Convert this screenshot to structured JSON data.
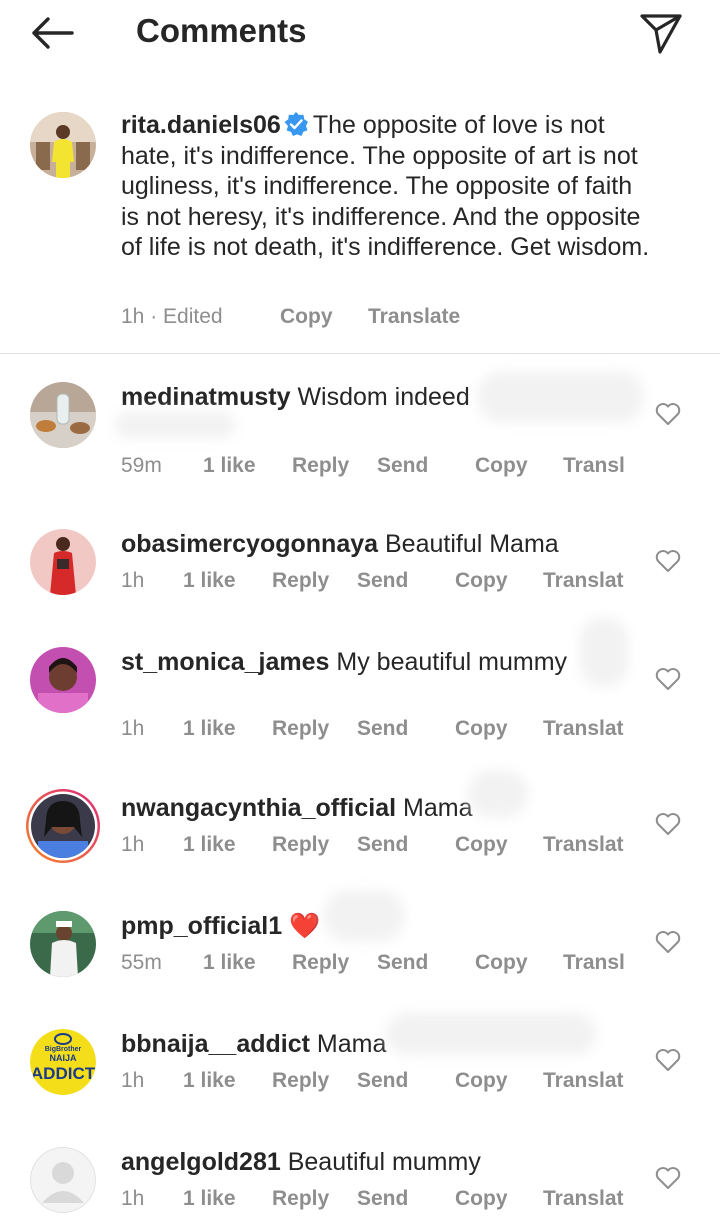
{
  "header": {
    "title": "Comments"
  },
  "caption": {
    "username": "rita.daniels06",
    "text": "The opposite of love is not hate, it's indifference. The opposite of art is not ugliness, it's indifference. The opposite of faith is not heresy, it's indifference. And the opposite of life is not death, it's indifference. Get wisdom.",
    "time": "1h · Edited",
    "copy": "Copy",
    "translate": "Translate"
  },
  "comments": [
    {
      "username": "medinatmusty",
      "text": "Wisdom indeed",
      "time": "59m",
      "likes": "1 like",
      "reply": "Reply",
      "send": "Send",
      "copy": "Copy",
      "translate": "Transl"
    },
    {
      "username": "obasimercyogonnaya",
      "text": "Beautiful Mama",
      "time": "1h",
      "likes": "1 like",
      "reply": "Reply",
      "send": "Send",
      "copy": "Copy",
      "translate": "Translat"
    },
    {
      "username": "st_monica_james",
      "text": "My beautiful mummy",
      "time": "1h",
      "likes": "1 like",
      "reply": "Reply",
      "send": "Send",
      "copy": "Copy",
      "translate": "Translat"
    },
    {
      "username": "nwangacynthia_official",
      "text": "Mama",
      "time": "1h",
      "likes": "1 like",
      "reply": "Reply",
      "send": "Send",
      "copy": "Copy",
      "translate": "Translat"
    },
    {
      "username": "pmp_official1",
      "text": "❤️",
      "time": "55m",
      "likes": "1 like",
      "reply": "Reply",
      "send": "Send",
      "copy": "Copy",
      "translate": "Transl"
    },
    {
      "username": "bbnaija__addict",
      "text": "Mama",
      "time": "1h",
      "likes": "1 like",
      "reply": "Reply",
      "send": "Send",
      "copy": "Copy",
      "translate": "Translat"
    },
    {
      "username": "angelgold281",
      "text": "Beautiful mummy",
      "time": "1h",
      "likes": "1 like",
      "reply": "Reply",
      "send": "Send",
      "copy": "Copy",
      "translate": "Translat"
    }
  ],
  "avatar_logo": {
    "line1": "BigBrother",
    "line2": "NAIJA",
    "line3": "ADDICT"
  },
  "colors": {
    "text": "#262626",
    "meta": "#8e8e8e",
    "verified": "#3897f0",
    "heart_emoji": "#e0302a",
    "story_ring_start": "#f58529",
    "story_ring_end": "#dd2a7b",
    "bbn_logo_bg": "#f4de1a"
  },
  "icons": [
    "back-arrow-icon",
    "send-direct-icon",
    "verified-badge-icon",
    "heart-outline-icon"
  ]
}
